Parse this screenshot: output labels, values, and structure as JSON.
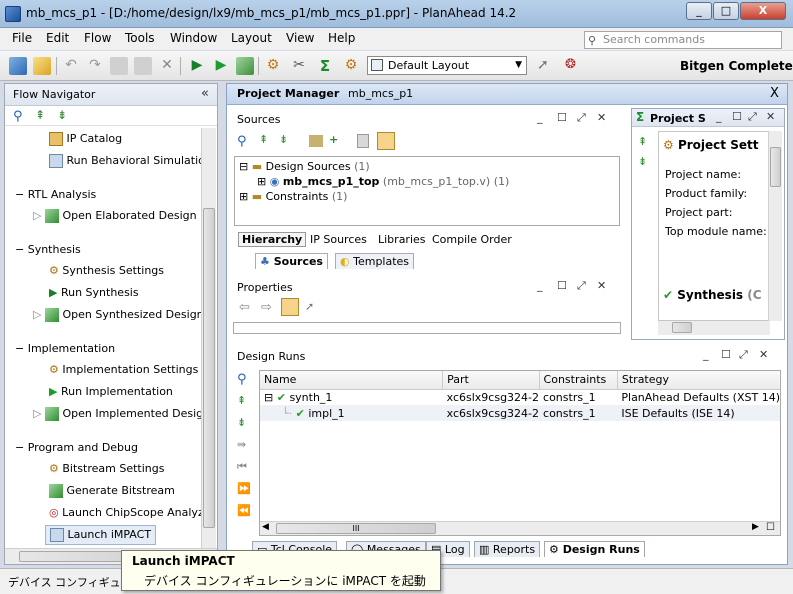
{
  "window": {
    "title": "mb_mcs_p1 - [D:/home/design/lx9/mb_mcs_p1/mb_mcs_p1.ppr] - PlanAhead  14.2",
    "minimize": "_",
    "maximize": "□",
    "close": "X"
  },
  "menu": [
    "File",
    "Edit",
    "Flow",
    "Tools",
    "Window",
    "Layout",
    "View",
    "Help"
  ],
  "search": {
    "placeholder": "Search commands"
  },
  "toolbar": {
    "layout": "Default Layout",
    "status": "Bitgen Complete"
  },
  "flow_navigator": {
    "title": "Flow Navigator",
    "collapse": "«",
    "top_items": [
      {
        "label": "IP Catalog",
        "icon": "ip-catalog-icon"
      },
      {
        "label": "Run Behavioral Simulation",
        "icon": "simulation-icon"
      }
    ],
    "sections": [
      {
        "title": "RTL Analysis",
        "items": [
          {
            "label": "Open Elaborated Design",
            "icon": "open-design-icon"
          }
        ]
      },
      {
        "title": "Synthesis",
        "items": [
          {
            "label": "Synthesis Settings",
            "icon": "gear-icon"
          },
          {
            "label": "Run Synthesis",
            "icon": "run-icon"
          },
          {
            "label": "Open Synthesized Design",
            "icon": "open-design-icon"
          }
        ]
      },
      {
        "title": "Implementation",
        "items": [
          {
            "label": "Implementation Settings",
            "icon": "gear-icon"
          },
          {
            "label": "Run Implementation",
            "icon": "run-icon"
          },
          {
            "label": "Open Implemented Design",
            "icon": "open-design-icon"
          }
        ]
      },
      {
        "title": "Program and Debug",
        "items": [
          {
            "label": "Bitstream Settings",
            "icon": "gear-icon"
          },
          {
            "label": "Generate Bitstream",
            "icon": "bitstream-icon"
          },
          {
            "label": "Launch ChipScope Analyzer",
            "icon": "chipscope-icon"
          },
          {
            "label": "Launch iMPACT",
            "icon": "impact-icon"
          }
        ]
      }
    ]
  },
  "project_manager": {
    "title": "Project Manager",
    "subtitle": "mb_mcs_p1",
    "close": "X"
  },
  "sources": {
    "title": "Sources",
    "tree": {
      "design_sources": "Design Sources",
      "design_sources_count": "(1)",
      "top_module": "mb_mcs_p1_top",
      "top_module_file": "(mb_mcs_p1_top.v)",
      "top_module_count": "(1)",
      "constraints": "Constraints",
      "constraints_count": "(1)"
    },
    "tabs": [
      "Hierarchy",
      "IP Sources",
      "Libraries",
      "Compile Order"
    ],
    "view_tabs": [
      "Sources",
      "Templates"
    ]
  },
  "project_summary": {
    "title": "Project S",
    "header": "Project Sett",
    "rows": [
      "Project name:",
      "Product family:",
      "Project part:",
      "Top module name:"
    ],
    "synthesis": "Synthesis",
    "synthesis_suffix": "(C"
  },
  "properties": {
    "title": "Properties"
  },
  "design_runs": {
    "title": "Design Runs",
    "columns": [
      "Name",
      "Part",
      "Constraints",
      "Strategy"
    ],
    "rows": [
      {
        "name": "synth_1",
        "part": "xc6slx9csg324-2",
        "constraints": "constrs_1",
        "strategy": "PlanAhead Defaults (XST 14)"
      },
      {
        "name": "impl_1",
        "part": "xc6slx9csg324-2",
        "constraints": "constrs_1",
        "strategy": "ISE Defaults (ISE 14)"
      }
    ],
    "scroll_mark": "III"
  },
  "bottom_tabs": [
    "Tcl Console",
    "Messages",
    "Log",
    "Reports",
    "Design Runs"
  ],
  "tooltip": {
    "title": "Launch iMPACT",
    "desc": "デバイス コンフィギュレーションに iMPACT を起動"
  },
  "statusbar": {
    "text": "デバイス コンフィギュレー"
  }
}
